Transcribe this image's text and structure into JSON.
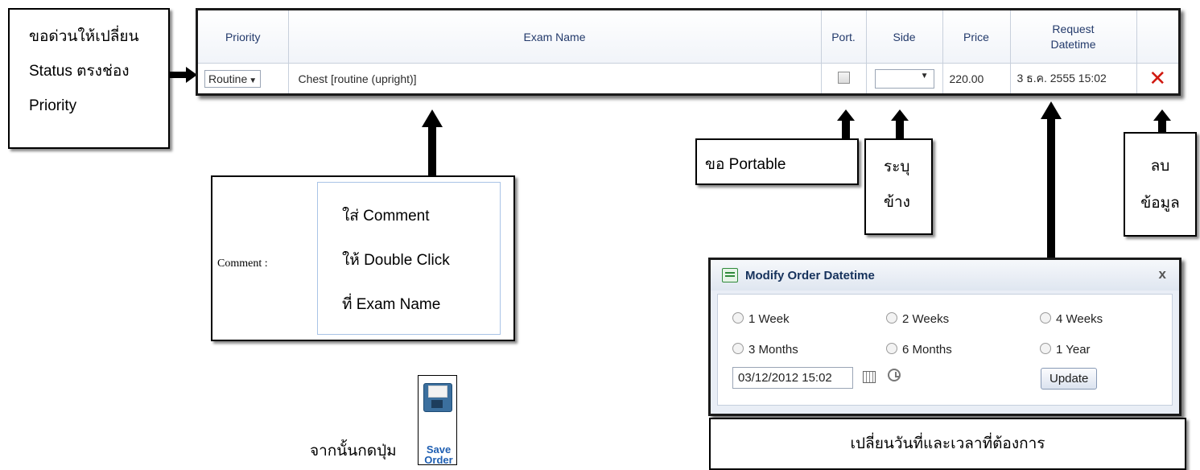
{
  "grid": {
    "headers": {
      "priority": "Priority",
      "exam_name": "Exam Name",
      "port": "Port.",
      "side": "Side",
      "price": "Price",
      "request_datetime_line1": "Request",
      "request_datetime_line2": "Datetime"
    },
    "row": {
      "priority": "Routine",
      "exam_name": "Chest [routine (upright)]",
      "side": "",
      "price": "220.00",
      "request_datetime": "3 ธ.ค. 2555 15:02",
      "delete_symbol": "✕"
    }
  },
  "callouts": {
    "priority": [
      "ขอด่วนให้เปลี่ยน",
      "Status ตรงช่อง",
      "Priority"
    ],
    "comment_label": "Comment :",
    "comment_help": [
      "ใส่ Comment",
      "ให้ Double Click",
      "ที่ Exam Name"
    ],
    "portable": "ขอ Portable",
    "side": [
      "ระบุ",
      "ข้าง"
    ],
    "delete": [
      "ลบ",
      "ข้อมูล"
    ],
    "datetime": "เปลี่ยนวันที่และเวลาที่ต้องการ",
    "save_prefix": "จากนั้นกดปุ่ม"
  },
  "dialog": {
    "title": "Modify Order Datetime",
    "close": "x",
    "options": [
      "1 Week",
      "2 Weeks",
      "4 Weeks",
      "3 Months",
      "6 Months",
      "1 Year"
    ],
    "datetime_value": "03/12/2012 15:02",
    "update_label": "Update"
  },
  "save_button": {
    "label": "Save Order"
  },
  "colors": {
    "accent": "#16325c",
    "delete": "#d0180f",
    "save": "#1f5fb2"
  }
}
